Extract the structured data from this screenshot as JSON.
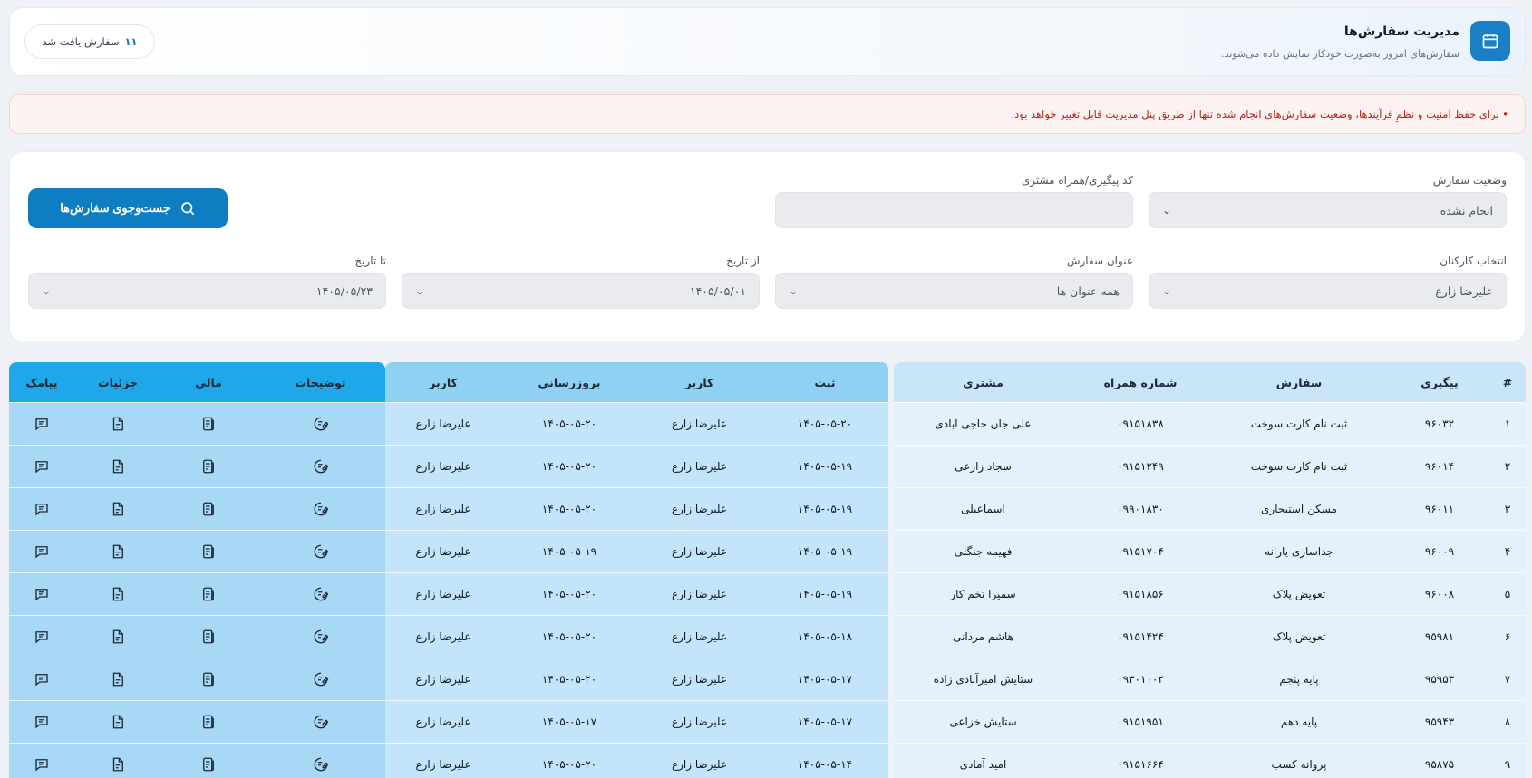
{
  "header": {
    "title": "مدیریت سفارش‌ها",
    "subtitle": "سفارش‌های امروز به‌صورت خودکار نمایش داده می‌شوند.",
    "count_num": "۱۱",
    "count_text": "سفارش یافت شد",
    "icon": "calendar-icon"
  },
  "alert": {
    "text": "• برای حفظ امنیت و نظمِ فرآیندها، وضعیت سفارش‌های انجام شده تنها از طریق پنل مدیریت قابل تغییر خواهد بود."
  },
  "filters": {
    "status_label": "وضعیت سفارش",
    "status_value": "انجام نشده",
    "tracking_label": "کد پیگیری/همراه مشتری",
    "tracking_value": "",
    "staff_label": "انتخاب کارکنان",
    "staff_value": "علیرضا زارع",
    "title_label": "عنوان سفارش",
    "title_value": "همه عنوان ها",
    "from_label": "از تاریخ",
    "from_value": "۱۴۰۵/۰۵/۰۱",
    "to_label": "تا تاریخ",
    "to_value": "۱۴۰۵/۰۵/۲۳",
    "search_button": "جست‌وجوی سفارش‌ها"
  },
  "table": {
    "headers": {
      "index": "#",
      "tracking": "پیگیری",
      "order": "سفارش",
      "phone": "شماره همراه",
      "customer": "مشتری",
      "registered": "ثبت",
      "user": "کاربر",
      "updated": "بروزرسانی",
      "user2": "کاربر",
      "notes": "توضیحات",
      "finance": "مالی",
      "details": "جزئیات",
      "sms": "پیامک"
    },
    "rows": [
      {
        "i": "۱",
        "tracking": "۹۶۰۳۲",
        "order": "ثبت نام کارت سوخت",
        "phone": "۰۹۱۵۱۸۳۸",
        "customer": "علی جان حاجی آبادی",
        "registered": "۱۴۰۵-۰۵-۲۰",
        "user": "علیرضا زارع",
        "updated": "۱۴۰۵-۰۵-۲۰",
        "user2": "علیرضا زارع"
      },
      {
        "i": "۲",
        "tracking": "۹۶۰۱۴",
        "order": "ثبت نام کارت سوخت",
        "phone": "۰۹۱۵۱۲۴۹",
        "customer": "سجاد زارعی",
        "registered": "۱۴۰۵-۰۵-۱۹",
        "user": "علیرضا زارع",
        "updated": "۱۴۰۵-۰۵-۲۰",
        "user2": "علیرضا زارع"
      },
      {
        "i": "۳",
        "tracking": "۹۶۰۱۱",
        "order": "مسکن استیجاری",
        "phone": "۰۹۹۰۱۸۳۰",
        "customer": "اسماعیلی",
        "registered": "۱۴۰۵-۰۵-۱۹",
        "user": "علیرضا زارع",
        "updated": "۱۴۰۵-۰۵-۲۰",
        "user2": "علیرضا زارع"
      },
      {
        "i": "۴",
        "tracking": "۹۶۰۰۹",
        "order": "جداسازی یارانه",
        "phone": "۰۹۱۵۱۷۰۴",
        "customer": "فهیمه جنگلی",
        "registered": "۱۴۰۵-۰۵-۱۹",
        "user": "علیرضا زارع",
        "updated": "۱۴۰۵-۰۵-۱۹",
        "user2": "علیرضا زارع"
      },
      {
        "i": "۵",
        "tracking": "۹۶۰۰۸",
        "order": "تعویض پلاک",
        "phone": "۰۹۱۵۱۸۵۶",
        "customer": "سمیرا تخم کار",
        "registered": "۱۴۰۵-۰۵-۱۹",
        "user": "علیرضا زارع",
        "updated": "۱۴۰۵-۰۵-۲۰",
        "user2": "علیرضا زارع"
      },
      {
        "i": "۶",
        "tracking": "۹۵۹۸۱",
        "order": "تعویض پلاک",
        "phone": "۰۹۱۵۱۴۲۴",
        "customer": "هاشم مردانی",
        "registered": "۱۴۰۵-۰۵-۱۸",
        "user": "علیرضا زارع",
        "updated": "۱۴۰۵-۰۵-۲۰",
        "user2": "علیرضا زارع"
      },
      {
        "i": "۷",
        "tracking": "۹۵۹۵۳",
        "order": "پایه پنجم",
        "phone": "۰۹۳۰۱۰۰۲",
        "customer": "ستایش امیرآبادی زاده",
        "registered": "۱۴۰۵-۰۵-۱۷",
        "user": "علیرضا زارع",
        "updated": "۱۴۰۵-۰۵-۲۰",
        "user2": "علیرضا زارع"
      },
      {
        "i": "۸",
        "tracking": "۹۵۹۴۳",
        "order": "پایه دهم",
        "phone": "۰۹۱۵۱۹۵۱",
        "customer": "ستایش خزاعی",
        "registered": "۱۴۰۵-۰۵-۱۷",
        "user": "علیرضا زارع",
        "updated": "۱۴۰۵-۰۵-۱۷",
        "user2": "علیرضا زارع"
      },
      {
        "i": "۹",
        "tracking": "۹۵۸۷۵",
        "order": "پروانه کسب",
        "phone": "۰۹۱۵۱۶۶۴",
        "customer": "امید آمادی",
        "registered": "۱۴۰۵-۰۵-۱۴",
        "user": "علیرضا زارع",
        "updated": "۱۴۰۵-۰۵-۲۰",
        "user2": "علیرضا زارع"
      }
    ]
  },
  "icons": {
    "notes": "note-edit-icon",
    "finance": "receipt-icon",
    "details": "document-icon",
    "sms": "message-icon"
  }
}
